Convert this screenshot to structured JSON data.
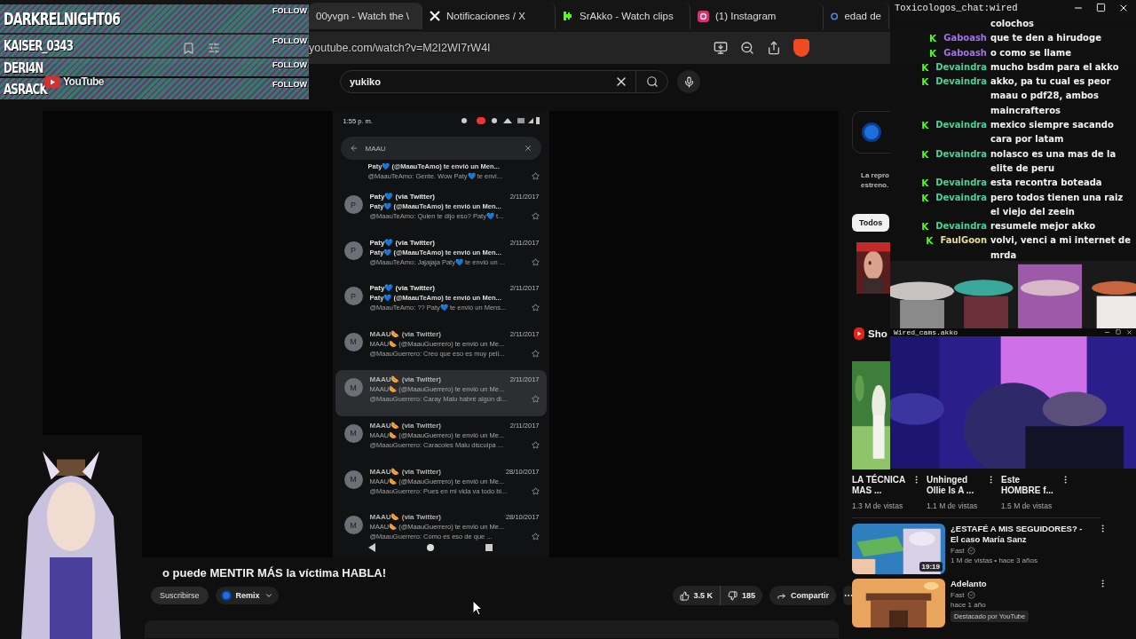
{
  "browser": {
    "tabs": [
      {
        "label": "00yvgn - Watch the \\",
        "kind": "plain",
        "selected": true
      },
      {
        "label": "Notificaciones / X",
        "kind": "x",
        "selected": false
      },
      {
        "label": "SrAkko - Watch clips",
        "kind": "kick",
        "selected": false
      },
      {
        "label": "(1) Instagram",
        "kind": "instagram",
        "selected": false
      },
      {
        "label": "edad de",
        "kind": "google",
        "selected": false
      }
    ],
    "address": "youtube.com/watch?v=M2I2WI7rW4I"
  },
  "youtube": {
    "logo": "YouTube",
    "search": {
      "value": "yukiko"
    },
    "phone": {
      "time": "1:55 p. m.",
      "search": "MAAU",
      "emails": [
        {
          "kind": "cut",
          "subject": "Paty💙 (@MaauTeAmo) te envió un Men...",
          "preview": "@MaauTeAmo: Gente. Wow Paty💙 te envi...",
          "selected": false
        },
        {
          "kind": "full",
          "avatar": "P",
          "sender": "Paty💙 (via Twitter)",
          "date": "2/11/2017",
          "subject": "Paty💙 (@MaauTeAmo) te envió un Men...",
          "preview": "@MaauTeAmo: Quien te dijo eso? Paty💙 t...",
          "selected": false
        },
        {
          "kind": "full",
          "avatar": "P",
          "sender": "Paty💙 (via Twitter)",
          "date": "2/11/2017",
          "subject": "Paty💙 (@MaauTeAmo) te envió un Men...",
          "preview": "@MaauTeAmo: Jajajaja Paty💙 te envió un ...",
          "selected": false
        },
        {
          "kind": "full",
          "avatar": "P",
          "sender": "Paty💙 (via Twitter)",
          "date": "2/11/2017",
          "subject": "Paty💙 (@MaauTeAmo) te envió un Men...",
          "preview": "@MaauTeAmo: ?? Paty💙 te envió un Mens...",
          "selected": false
        },
        {
          "kind": "full",
          "avatar": "M",
          "sender": "MAAU🌭 (via Twitter)",
          "date": "2/11/2017",
          "subject": "MAAU🌭 (@MaauGuerrero) te envió un Me...",
          "preview": "@MaauGuerrero: Creo que eso es muy peli...",
          "selected": false
        },
        {
          "kind": "full",
          "avatar": "M",
          "sender": "MAAU🌭 (via Twitter)",
          "date": "2/11/2017",
          "subject": "MAAU🌭 (@MaauGuerrero) te envió un Me...",
          "preview": "@MaauGuerrero: Caray Malu habré algún di...",
          "selected": true
        },
        {
          "kind": "full",
          "avatar": "M",
          "sender": "MAAU🌭 (via Twitter)",
          "date": "2/11/2017",
          "subject": "MAAU🌭 (@MaauGuerrero) te envió un Me...",
          "preview": "@MaauGuerrero: Caracoles Malu disculpa ...",
          "selected": false
        },
        {
          "kind": "full",
          "avatar": "M",
          "sender": "MAAU🌭 (via Twitter)",
          "date": "28/10/2017",
          "subject": "MAAU🌭 (@MaauGuerrero) te envió un Me...",
          "preview": "@MaauGuerrero: Pues en mi vida va todo bi...",
          "selected": false
        },
        {
          "kind": "full",
          "avatar": "M",
          "sender": "MAAU🌭 (via Twitter)",
          "date": "28/10/2017",
          "subject": "MAAU🌭 (@MaauGuerrero) te envió un Me...",
          "preview": "@MaauGuerrero: Como es eso de que ...",
          "selected": false
        }
      ]
    },
    "title": "o puede MENTIR MÁS la víctima HABLA!",
    "actions": {
      "subscribe": "Suscribirse",
      "remix": "Remix",
      "likes": "3.5 K",
      "dislikes": "185",
      "share": "Compartir"
    },
    "sidebar": {
      "notice": [
        "La repro",
        "estreno."
      ],
      "chips": [
        {
          "label": "Todos",
          "selected": true
        }
      ],
      "shorts_header": "Sho",
      "shorts": [
        {
          "title": "LA TÉCNICA MAS ...",
          "views": "1.3 M de vistas"
        },
        {
          "title": "Unhinged Ollie Is A ...",
          "views": "1.1 M de vistas"
        },
        {
          "title": "Este HOMBRE f...",
          "views": "1.5 M de vistas"
        }
      ],
      "videos": [
        {
          "title": "¿ESTAFÉ A MIS SEGUIDORES? - El caso María Sanz",
          "channel": "Fast",
          "meta": "1 M de vistas • hace 3 años",
          "duration": "19:19"
        },
        {
          "title": "Adelanto",
          "channel": "Fast",
          "meta": "hace 1 año",
          "badge": "Destacado por YouTube"
        }
      ]
    }
  },
  "overlays": {
    "follows": [
      {
        "name": "DARKRELNIGHT06",
        "button": "FOLLOW"
      },
      {
        "name": "KAISER_0343",
        "button": "FOLLOW"
      },
      {
        "name": "DERI4N",
        "button": "FOLLOW"
      },
      {
        "name": "ASRACK",
        "button": "FOLLOW"
      }
    ],
    "chat": {
      "title": "Toxicologos_chat:wired",
      "messages": [
        {
          "text": "colochos"
        },
        {
          "badge": "K",
          "user": "Gaboash",
          "color": "#a272e6",
          "text": "que te den a hirudoge"
        },
        {
          "badge": "K",
          "user": "Gaboash",
          "color": "#a272e6",
          "text": "o como se llame"
        },
        {
          "badge": "K",
          "user": "Devaindra",
          "color": "#46d39b",
          "text": "mucho bsdm para el akko"
        },
        {
          "badge": "K",
          "user": "Devaindra",
          "color": "#46d39b",
          "text": "akko, pa tu cual es peor maau o pdf28, ambos maincrafteros"
        },
        {
          "badge": "K",
          "user": "Devaindra",
          "color": "#46d39b",
          "text": "mexico siempre sacando cara por latam"
        },
        {
          "badge": "K",
          "user": "Devaindra",
          "color": "#46d39b",
          "text": "nolasco es una mas de la elite de peru"
        },
        {
          "badge": "K",
          "user": "Devaindra",
          "color": "#46d39b",
          "text": "esta recontra boteada"
        },
        {
          "badge": "K",
          "user": "Devaindra",
          "color": "#46d39b",
          "text": "pero todos tienen una raiz el viejo del zeein"
        },
        {
          "badge": "K",
          "user": "Devaindra",
          "color": "#46d39b",
          "text": "resumele mejor akko"
        },
        {
          "badge": "K",
          "user": "FaulGoon",
          "color": "#e9dca2",
          "text": "volvi, venci a mi internet de mrda"
        }
      ]
    },
    "cam": {
      "title": "Wired_cams.akko"
    }
  }
}
